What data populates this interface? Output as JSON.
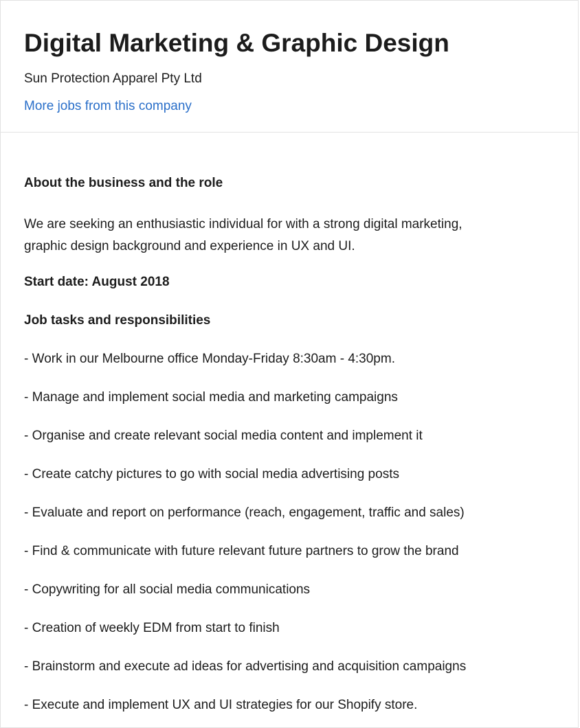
{
  "header": {
    "title": "Digital Marketing & Graphic Design",
    "company": "Sun Protection Apparel Pty Ltd",
    "more_jobs_link": "More jobs from this company"
  },
  "content": {
    "about_heading": "About the business and the role",
    "about_text": "We are seeking an enthusiastic individual for with a strong digital marketing, graphic design background and experience in UX and UI.",
    "start_date": "Start date: August 2018",
    "tasks_heading": "Job tasks and responsibilities",
    "tasks": [
      "- Work in our Melbourne office Monday-Friday 8:30am - 4:30pm.",
      "- Manage and implement social media and marketing campaigns",
      "- Organise and create relevant social media content and implement it",
      "- Create catchy pictures to go with social media advertising posts",
      "- Evaluate and report on performance (reach, engagement, traffic and sales)",
      "- Find & communicate with future relevant future partners to grow the brand",
      "- Copywriting for all social media communications",
      "- Creation of weekly EDM from start to finish",
      "- Brainstorm and execute ad ideas for advertising and acquisition campaigns",
      "- Execute and implement UX and UI strategies for our Shopify store."
    ]
  },
  "colors": {
    "link": "#2a6fc9",
    "text": "#1c1c1c",
    "border": "#e2e2e2"
  }
}
